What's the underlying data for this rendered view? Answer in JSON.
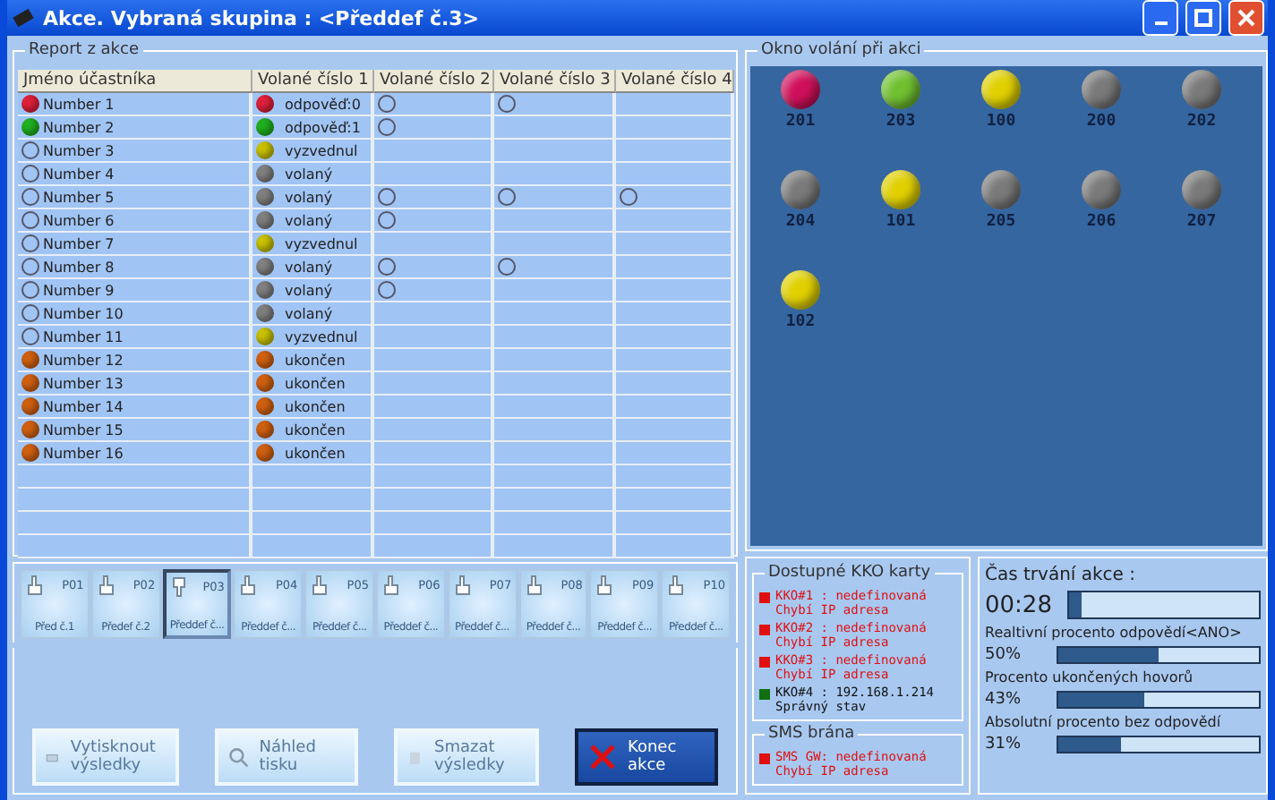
{
  "window": {
    "title": "Akce. Vybraná skupina : <Předdef č.3>"
  },
  "report": {
    "title": "Report z akce",
    "columns": [
      "Jméno účastníka",
      "Volané číslo 1",
      "Volané číslo 2",
      "Volané číslo 3",
      "Volané číslo 4"
    ],
    "rows": [
      {
        "name": "Number 1",
        "kind": "filled",
        "color": "#e0203a",
        "call": {
          "text": "odpověď:0",
          "color": "#e0203a"
        },
        "attempts": [
          true,
          true,
          false
        ]
      },
      {
        "name": "Number 2",
        "kind": "filled",
        "color": "#20b020",
        "call": {
          "text": "odpověď:1",
          "color": "#20b020"
        },
        "attempts": [
          true,
          false,
          false
        ]
      },
      {
        "name": "Number 3",
        "kind": "empty",
        "call": {
          "text": "vyzvednul",
          "color": "#c8c000"
        },
        "attempts": [
          false,
          false,
          false
        ]
      },
      {
        "name": "Number 4",
        "kind": "empty",
        "call": {
          "text": "volaný",
          "color": "#808080"
        },
        "attempts": [
          false,
          false,
          false
        ]
      },
      {
        "name": "Number 5",
        "kind": "empty",
        "call": {
          "text": "volaný",
          "color": "#808080"
        },
        "attempts": [
          true,
          true,
          true
        ]
      },
      {
        "name": "Number 6",
        "kind": "empty",
        "call": {
          "text": "volaný",
          "color": "#808080"
        },
        "attempts": [
          true,
          false,
          false
        ]
      },
      {
        "name": "Number 7",
        "kind": "empty",
        "call": {
          "text": "vyzvednul",
          "color": "#c8c000"
        },
        "attempts": [
          false,
          false,
          false
        ]
      },
      {
        "name": "Number 8",
        "kind": "empty",
        "call": {
          "text": "volaný",
          "color": "#808080"
        },
        "attempts": [
          true,
          true,
          false
        ]
      },
      {
        "name": "Number 9",
        "kind": "empty",
        "call": {
          "text": "volaný",
          "color": "#808080"
        },
        "attempts": [
          true,
          false,
          false
        ]
      },
      {
        "name": "Number 10",
        "kind": "empty",
        "call": {
          "text": "volaný",
          "color": "#808080"
        },
        "attempts": [
          false,
          false,
          false
        ]
      },
      {
        "name": "Number 11",
        "kind": "empty",
        "call": {
          "text": "vyzvednul",
          "color": "#c8c000"
        },
        "attempts": [
          false,
          false,
          false
        ]
      },
      {
        "name": "Number 12",
        "kind": "filled",
        "color": "#d06010",
        "call": {
          "text": "ukončen",
          "color": "#d06010"
        },
        "attempts": [
          false,
          false,
          false
        ]
      },
      {
        "name": "Number 13",
        "kind": "filled",
        "color": "#d06010",
        "call": {
          "text": "ukončen",
          "color": "#d06010"
        },
        "attempts": [
          false,
          false,
          false
        ]
      },
      {
        "name": "Number 14",
        "kind": "filled",
        "color": "#d06010",
        "call": {
          "text": "ukončen",
          "color": "#d06010"
        },
        "attempts": [
          false,
          false,
          false
        ]
      },
      {
        "name": "Number 15",
        "kind": "filled",
        "color": "#d06010",
        "call": {
          "text": "ukončen",
          "color": "#d06010"
        },
        "attempts": [
          false,
          false,
          false
        ]
      },
      {
        "name": "Number 16",
        "kind": "filled",
        "color": "#d06010",
        "call": {
          "text": "ukončen",
          "color": "#d06010"
        },
        "attempts": [
          false,
          false,
          false
        ]
      }
    ]
  },
  "presets": [
    {
      "code": "P01",
      "label": "Před č.1",
      "selected": false
    },
    {
      "code": "P02",
      "label": "Předef č.2",
      "selected": false
    },
    {
      "code": "P03",
      "label": "Předdef č...",
      "selected": true
    },
    {
      "code": "P04",
      "label": "Předdef č...",
      "selected": false
    },
    {
      "code": "P05",
      "label": "Předdef č...",
      "selected": false
    },
    {
      "code": "P06",
      "label": "Předdef č...",
      "selected": false
    },
    {
      "code": "P07",
      "label": "Předdef č...",
      "selected": false
    },
    {
      "code": "P08",
      "label": "Předdef č...",
      "selected": false
    },
    {
      "code": "P09",
      "label": "Předdef č...",
      "selected": false
    },
    {
      "code": "P10",
      "label": "Předdef č...",
      "selected": false
    }
  ],
  "actions": [
    {
      "kind": "print",
      "label": "Vytisknout výsledky",
      "disabled": true
    },
    {
      "kind": "preview",
      "label": "Náhled tisku",
      "disabled": true
    },
    {
      "kind": "delete",
      "label": "Smazat výsledky",
      "disabled": true
    },
    {
      "kind": "end",
      "label": "Konec akce",
      "disabled": false
    }
  ],
  "call_window": {
    "title": "Okno volání při akci",
    "extensions": [
      {
        "label": "201",
        "color": "#d0105a"
      },
      {
        "label": "203",
        "color": "#70c030"
      },
      {
        "label": "100",
        "color": "#e0d000"
      },
      {
        "label": "200",
        "color": "#7a7a7a"
      },
      {
        "label": "202",
        "color": "#7a7a7a"
      },
      {
        "label": "204",
        "color": "#7a7a7a"
      },
      {
        "label": "101",
        "color": "#e0d000"
      },
      {
        "label": "205",
        "color": "#7a7a7a"
      },
      {
        "label": "206",
        "color": "#7a7a7a"
      },
      {
        "label": "207",
        "color": "#7a7a7a"
      },
      {
        "label": "102",
        "color": "#e0d000"
      }
    ]
  },
  "cards": {
    "title": "Dostupné KKO karty",
    "items": [
      {
        "line1": "KKO#1 : nedefinovaná",
        "line2": "Chybí IP adresa",
        "color": "#e01010"
      },
      {
        "line1": "KKO#2 : nedefinovaná",
        "line2": "Chybí IP adresa",
        "color": "#e01010"
      },
      {
        "line1": "KKO#3 : nedefinovaná",
        "line2": "Chybí IP adresa",
        "color": "#e01010"
      },
      {
        "line1": "KKO#4 : 192.168.1.214",
        "line2": "Správný stav",
        "color": "#107010"
      }
    ]
  },
  "sms": {
    "title": "SMS brána",
    "items": [
      {
        "line1": "SMS GW: nedefinovaná",
        "line2": "Chybí IP adresa",
        "color": "#e01010"
      }
    ]
  },
  "duration": {
    "label": "Čas trvání akce :",
    "reading": "00:28",
    "level": 0.07
  },
  "stats": [
    {
      "label": "Realtivní procento odpovědí<ANO>",
      "reading": "50%",
      "level": 0.5
    },
    {
      "label": "Procento ukončených hovorů",
      "reading": "43%",
      "level": 0.43
    },
    {
      "label": "Absolutní procento bez odpovědí",
      "reading": "31%",
      "level": 0.31
    }
  ]
}
